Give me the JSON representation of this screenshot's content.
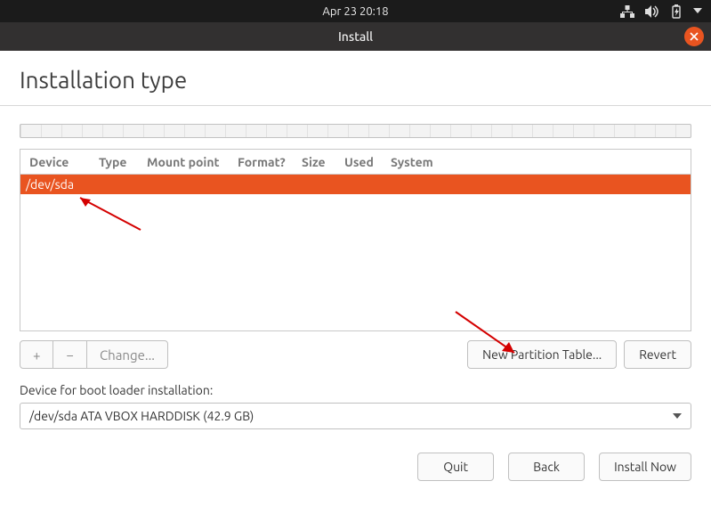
{
  "gnome_top": {
    "datetime": "Apr 23  20:18"
  },
  "window": {
    "title": "Install"
  },
  "page": {
    "heading": "Installation type"
  },
  "table": {
    "headers": {
      "device": "Device",
      "type": "Type",
      "mount": "Mount point",
      "format": "Format?",
      "size": "Size",
      "used": "Used",
      "system": "System"
    },
    "rows": [
      {
        "device": "/dev/sda"
      }
    ]
  },
  "toolbar": {
    "add": "+",
    "remove": "−",
    "change": "Change...",
    "new_table": "New Partition Table...",
    "revert": "Revert"
  },
  "boot": {
    "label": "Device for boot loader installation:",
    "selected": "/dev/sda  ATA VBOX HARDDISK (42.9 GB)"
  },
  "footer": {
    "quit": "Quit",
    "back": "Back",
    "install": "Install Now"
  }
}
